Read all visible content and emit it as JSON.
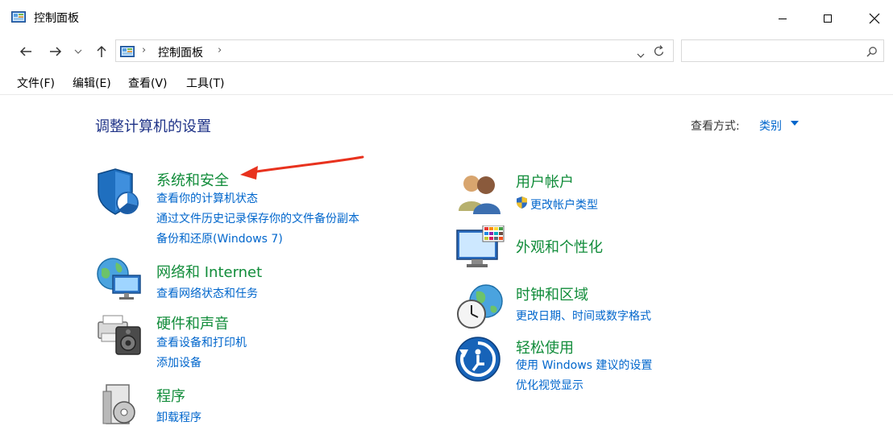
{
  "window": {
    "title": "控制面板"
  },
  "address_bar": {
    "path_segment": "控制面板",
    "search_value": ""
  },
  "menu": {
    "file": "文件(F)",
    "edit": "编辑(E)",
    "view": "查看(V)",
    "tools": "工具(T)"
  },
  "content": {
    "title": "调整计算机的设置",
    "view_by_label": "查看方式:",
    "view_by_value": "类别"
  },
  "categories": {
    "system_security": {
      "title": "系统和安全",
      "links": [
        "查看你的计算机状态",
        "通过文件历史记录保存你的文件备份副本",
        "备份和还原(Windows 7)"
      ]
    },
    "network": {
      "title": "网络和 Internet",
      "links": [
        "查看网络状态和任务"
      ]
    },
    "hardware": {
      "title": "硬件和声音",
      "links": [
        "查看设备和打印机",
        "添加设备"
      ]
    },
    "programs": {
      "title": "程序",
      "links": [
        "卸载程序"
      ]
    },
    "user_accounts": {
      "title": "用户帐户",
      "links": [
        "更改帐户类型"
      ]
    },
    "appearance": {
      "title": "外观和个性化",
      "links": []
    },
    "clock_region": {
      "title": "时钟和区域",
      "links": [
        "更改日期、时间或数字格式"
      ]
    },
    "ease_of_access": {
      "title": "轻松使用",
      "links": [
        "使用 Windows 建议的设置",
        "优化视觉显示"
      ]
    }
  },
  "colors": {
    "category_title": "#118c3a",
    "link": "#0066cc",
    "page_title": "#1e3287",
    "annotation_arrow": "#e8321e"
  },
  "icons": {
    "app": "control-panel-icon",
    "back": "back-arrow-icon",
    "forward": "forward-arrow-icon",
    "recent": "chevron-down-icon",
    "up": "up-arrow-icon",
    "refresh": "refresh-icon",
    "search": "search-icon"
  }
}
